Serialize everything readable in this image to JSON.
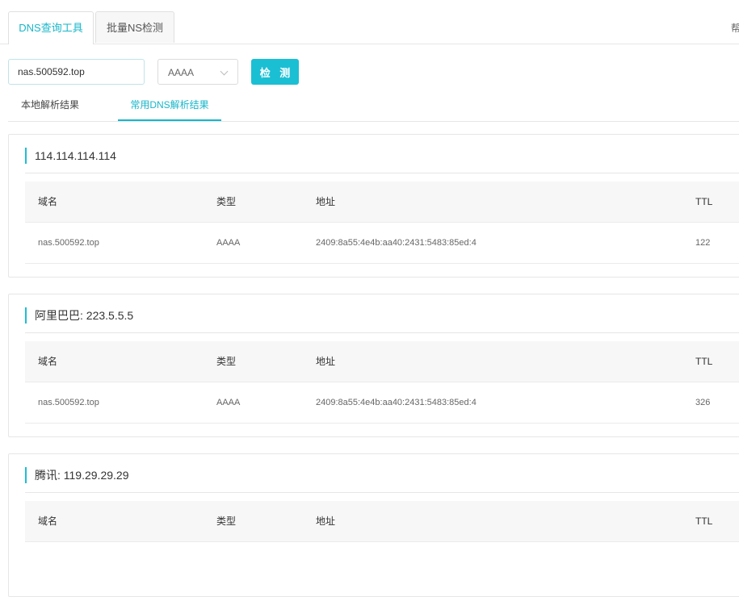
{
  "top_tabs": [
    {
      "label": "DNS查询工具",
      "active": true
    },
    {
      "label": "批量NS检测",
      "active": false
    }
  ],
  "help_link": "帮",
  "query": {
    "domain_value": "nas.500592.top",
    "record_type": "AAAA",
    "submit_label": "检 测"
  },
  "result_tabs": [
    {
      "label": "本地解析结果",
      "active": false
    },
    {
      "label": "常用DNS解析结果",
      "active": true
    }
  ],
  "columns": [
    "域名",
    "类型",
    "地址",
    "TTL"
  ],
  "servers": [
    {
      "title": "114.114.114.114",
      "rows": [
        {
          "domain": "nas.500592.top",
          "type": "AAAA",
          "address": "2409:8a55:4e4b:aa40:2431:5483:85ed:4",
          "ttl": "122"
        }
      ]
    },
    {
      "title": "阿里巴巴: 223.5.5.5",
      "rows": [
        {
          "domain": "nas.500592.top",
          "type": "AAAA",
          "address": "2409:8a55:4e4b:aa40:2431:5483:85ed:4",
          "ttl": "326"
        }
      ]
    },
    {
      "title": "腾讯: 119.29.29.29",
      "rows": []
    }
  ],
  "colors": {
    "accent": "#1bbfd4",
    "border": "#e6e6e6",
    "header_bg": "#f7f7f7"
  }
}
